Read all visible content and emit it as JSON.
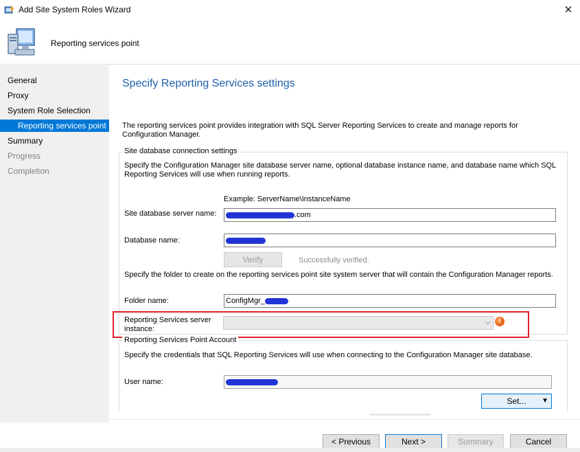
{
  "window": {
    "title": "Add Site System Roles Wizard",
    "close_glyph": "✕"
  },
  "header": {
    "title": "Reporting services point"
  },
  "nav": {
    "items": [
      {
        "label": "General",
        "state": "normal"
      },
      {
        "label": "Proxy",
        "state": "normal"
      },
      {
        "label": "System Role Selection",
        "state": "normal"
      },
      {
        "label": "Reporting services point",
        "state": "selected"
      },
      {
        "label": "Summary",
        "state": "normal"
      },
      {
        "label": "Progress",
        "state": "disabled"
      },
      {
        "label": "Completion",
        "state": "disabled"
      }
    ]
  },
  "page": {
    "heading": "Specify Reporting Services settings",
    "intro": "The reporting services point provides integration with SQL Server Reporting Services to create and manage reports for Configuration Manager."
  },
  "site_db": {
    "group_label": "Site database connection settings",
    "description": "Specify the Configuration Manager site database server name, optional database instance name, and database name which SQL Reporting Services will use when running reports.",
    "example": "Example: ServerName\\InstanceName",
    "server_label": "Site database server name:",
    "server_value_suffix": ".com",
    "dbname_label": "Database name:",
    "verify_button": "Verify",
    "verify_status": "Successfully verified.",
    "folder_description": "Specify the folder to create on the reporting services point site system server that will contain the Configuration Manager reports.",
    "folder_label": "Folder name:",
    "folder_value_prefix": "ConfigMgr_",
    "rs_instance_label": "Reporting Services server instance:",
    "rs_instance_value": ""
  },
  "account": {
    "group_label": "Reporting Services Point Account",
    "description": "Specify the credentials that SQL Reporting Services will use when connecting to the Configuration Manager site database.",
    "username_label": "User name:",
    "set_button": "Set..."
  },
  "footer": {
    "previous": "< Previous",
    "next": "Next >",
    "summary": "Summary",
    "cancel": "Cancel"
  },
  "colors": {
    "accent": "#0078d7",
    "heading": "#1e5fa8",
    "highlight_box": "#e0202a",
    "redaction": "#2234d6"
  }
}
